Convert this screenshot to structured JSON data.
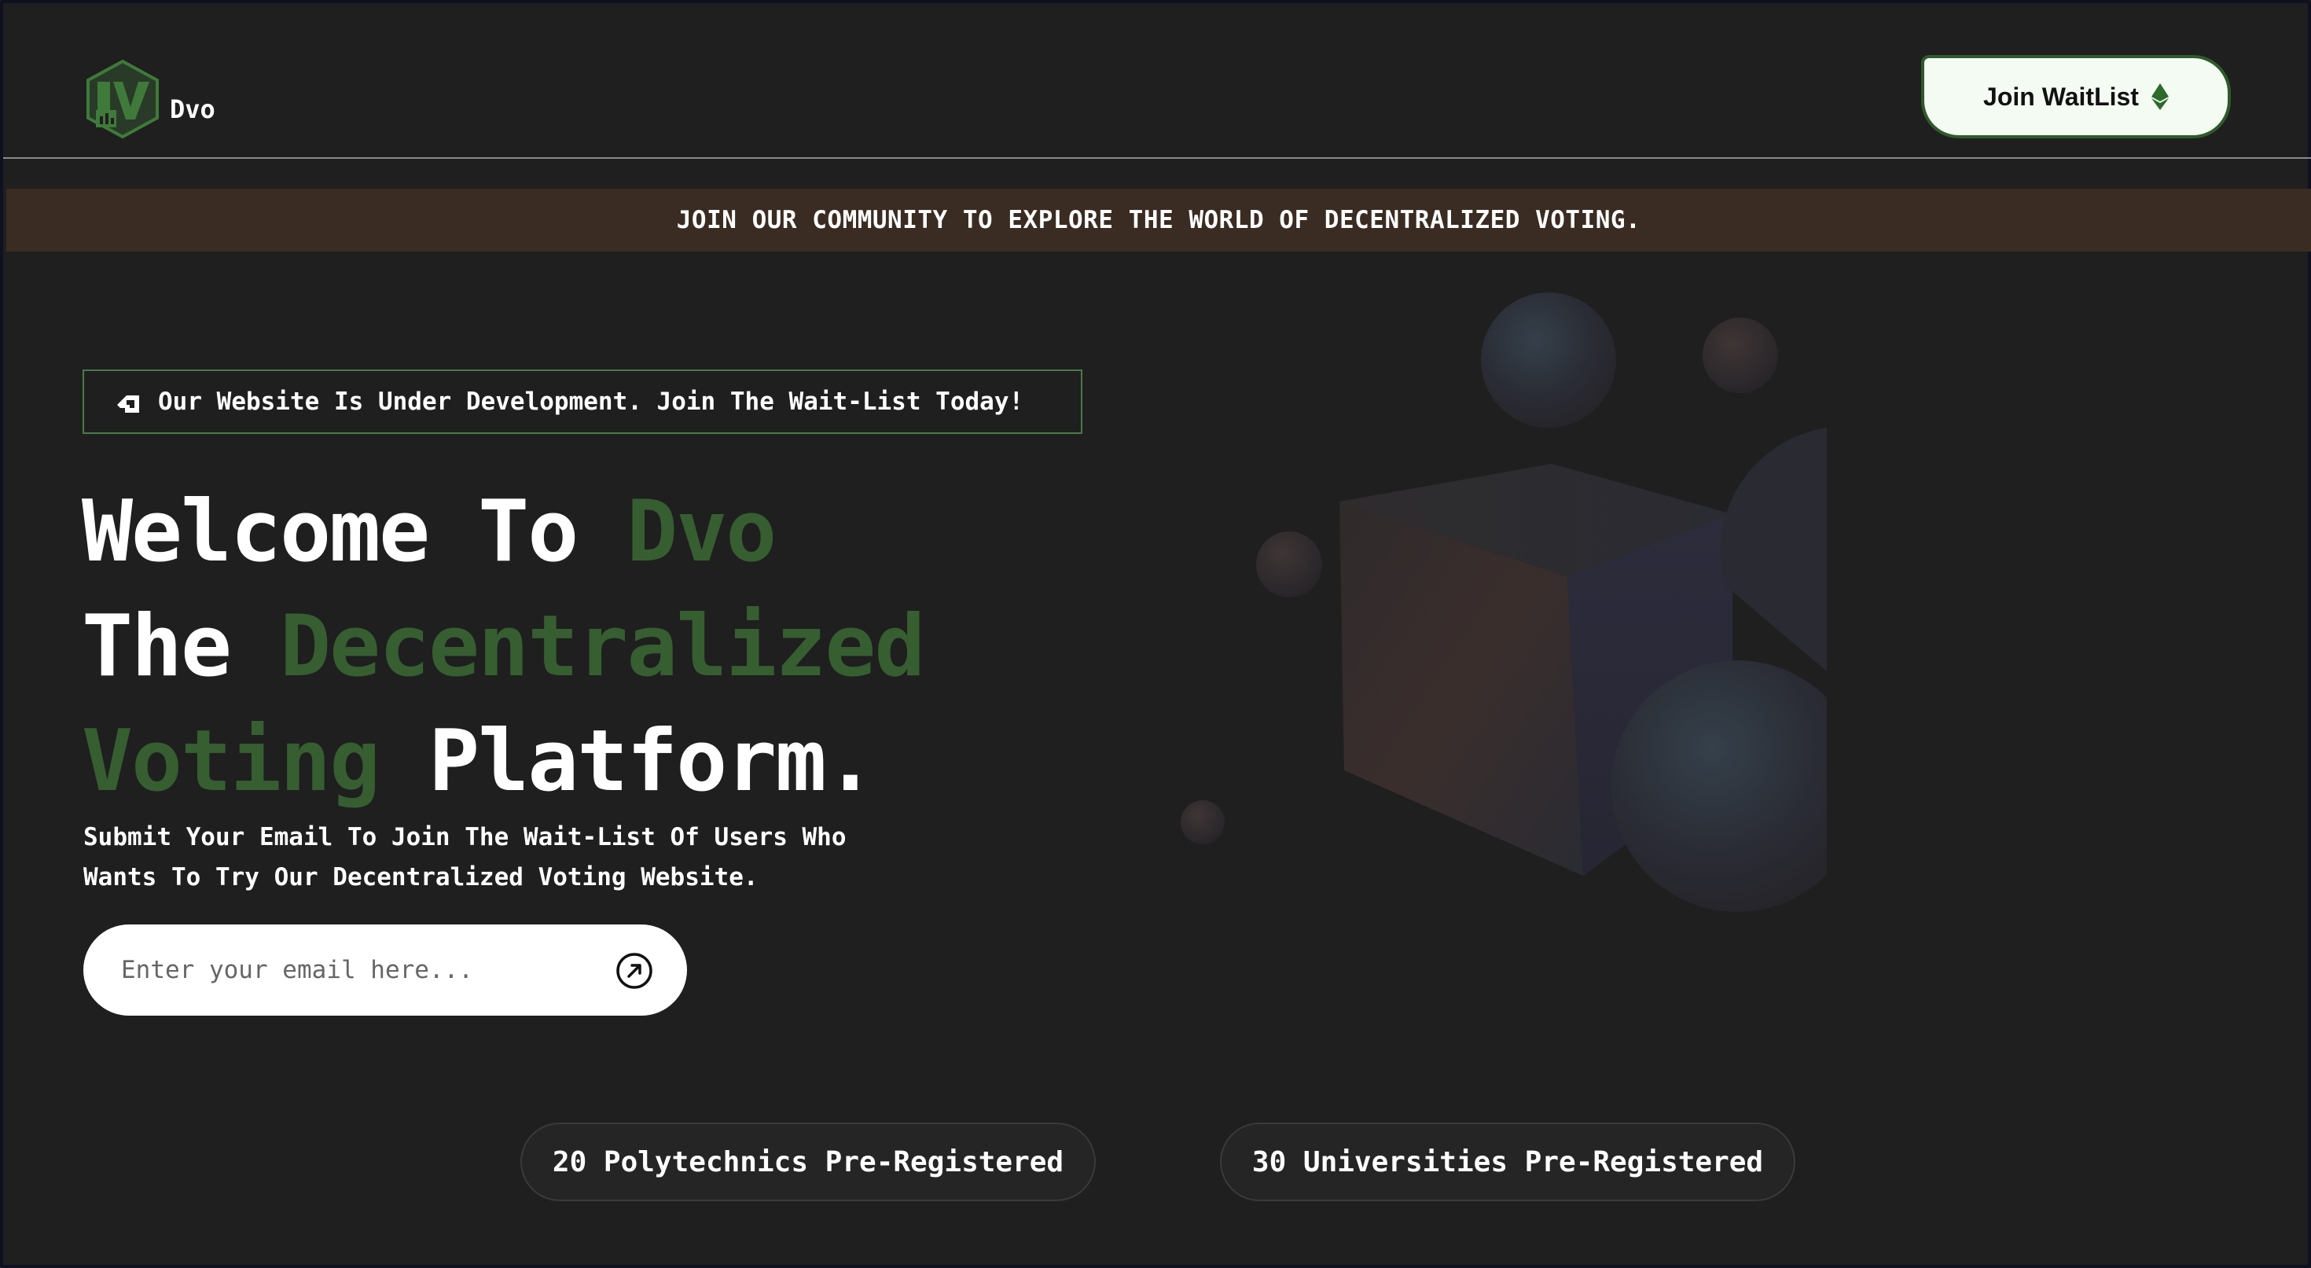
{
  "header": {
    "brand": "Dvo",
    "logo_icon": "dvo-hexagon-logo-icon",
    "join_button_label": "Join WaitList",
    "join_button_icon": "ethereum-icon"
  },
  "announcement": {
    "text": "JOIN OUR COMMUNITY TO EXPLORE THE WORLD OF DECENTRALIZED VOTING."
  },
  "hero": {
    "badge_icon": "stairs-icon",
    "badge_text": "Our Website Is Under Development. Join The Wait-List Today!",
    "title_line1_a": "Welcome To ",
    "title_line1_b": "Dvo",
    "title_line2_a": "The ",
    "title_line2_b": "Decentralized",
    "title_line3_a": "Voting",
    "title_line3_b": " Platform.",
    "subtitle_line1": "Submit Your Email To Join The Wait-List Of Users Who",
    "subtitle_line2": "Wants To Try Our Decentralized Voting Website.",
    "email_placeholder": "Enter your email here...",
    "email_value": "",
    "submit_icon": "arrow-up-right-circle-icon"
  },
  "stats": [
    {
      "label": "20 Polytechnics Pre-Registered"
    },
    {
      "label": "30 Universities Pre-Registered"
    }
  ],
  "colors": {
    "background": "#1f1f1f",
    "accent_green": "#365e31",
    "banner_brown": "#3a2c22",
    "button_bg": "#f3fbf2"
  }
}
